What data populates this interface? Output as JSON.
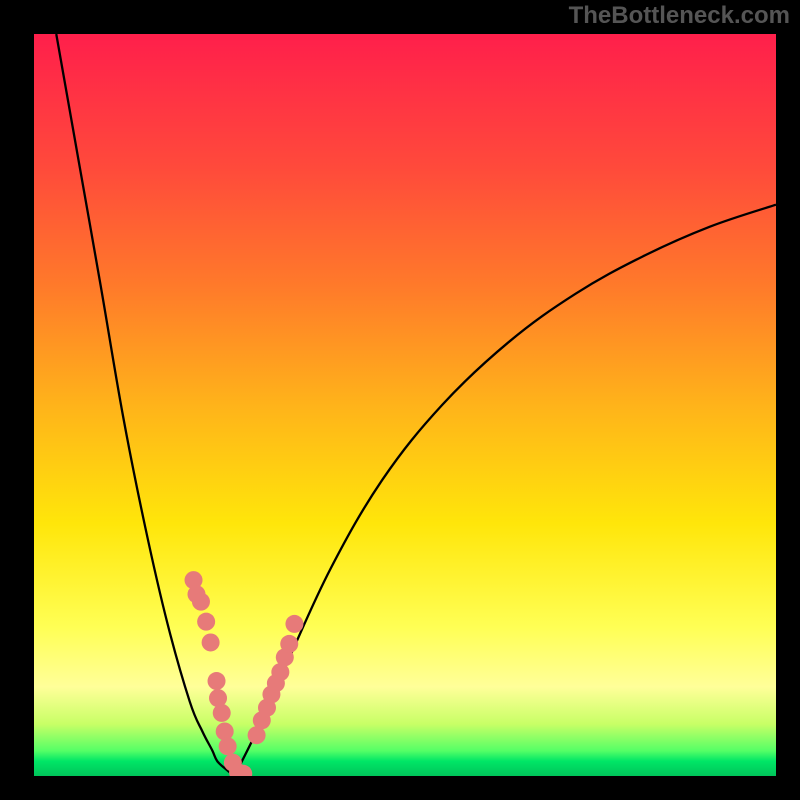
{
  "watermark": "TheBottleneck.com",
  "chart_data": {
    "type": "line",
    "title": "",
    "xlabel": "",
    "ylabel": "",
    "xlim": [
      0,
      1
    ],
    "ylim": [
      0,
      1
    ],
    "left_curve": {
      "x": [
        0.03,
        0.06,
        0.09,
        0.12,
        0.15,
        0.18,
        0.21,
        0.227,
        0.24,
        0.247,
        0.26,
        0.27
      ],
      "y": [
        1.0,
        0.83,
        0.66,
        0.485,
        0.335,
        0.205,
        0.1,
        0.06,
        0.035,
        0.02,
        0.008,
        0.0
      ]
    },
    "right_curve": {
      "x": [
        0.27,
        0.3,
        0.34,
        0.4,
        0.47,
        0.55,
        0.64,
        0.73,
        0.82,
        0.91,
        1.0
      ],
      "y": [
        0.0,
        0.06,
        0.15,
        0.28,
        0.4,
        0.5,
        0.585,
        0.65,
        0.7,
        0.74,
        0.77
      ]
    },
    "series": [
      {
        "name": "scatter-points",
        "x": [
          0.215,
          0.219,
          0.225,
          0.232,
          0.238,
          0.246,
          0.248,
          0.253,
          0.257,
          0.261,
          0.268,
          0.275,
          0.282,
          0.3,
          0.307,
          0.314,
          0.32,
          0.326,
          0.332,
          0.338,
          0.344,
          0.351
        ],
        "y": [
          0.264,
          0.245,
          0.235,
          0.208,
          0.18,
          0.128,
          0.105,
          0.085,
          0.06,
          0.04,
          0.018,
          0.005,
          0.003,
          0.055,
          0.075,
          0.092,
          0.11,
          0.125,
          0.14,
          0.16,
          0.178,
          0.205
        ]
      }
    ],
    "gradient_stops": [
      {
        "pos": 0.0,
        "color": "#ff1f4b"
      },
      {
        "pos": 0.18,
        "color": "#ff4a3b"
      },
      {
        "pos": 0.34,
        "color": "#ff7a2a"
      },
      {
        "pos": 0.5,
        "color": "#ffb31a"
      },
      {
        "pos": 0.66,
        "color": "#ffe60a"
      },
      {
        "pos": 0.8,
        "color": "#ffff55"
      },
      {
        "pos": 0.88,
        "color": "#ffff99"
      },
      {
        "pos": 0.93,
        "color": "#c8ff66"
      },
      {
        "pos": 0.966,
        "color": "#55ff66"
      },
      {
        "pos": 0.98,
        "color": "#00e666"
      },
      {
        "pos": 1.0,
        "color": "#00c45a"
      }
    ]
  }
}
